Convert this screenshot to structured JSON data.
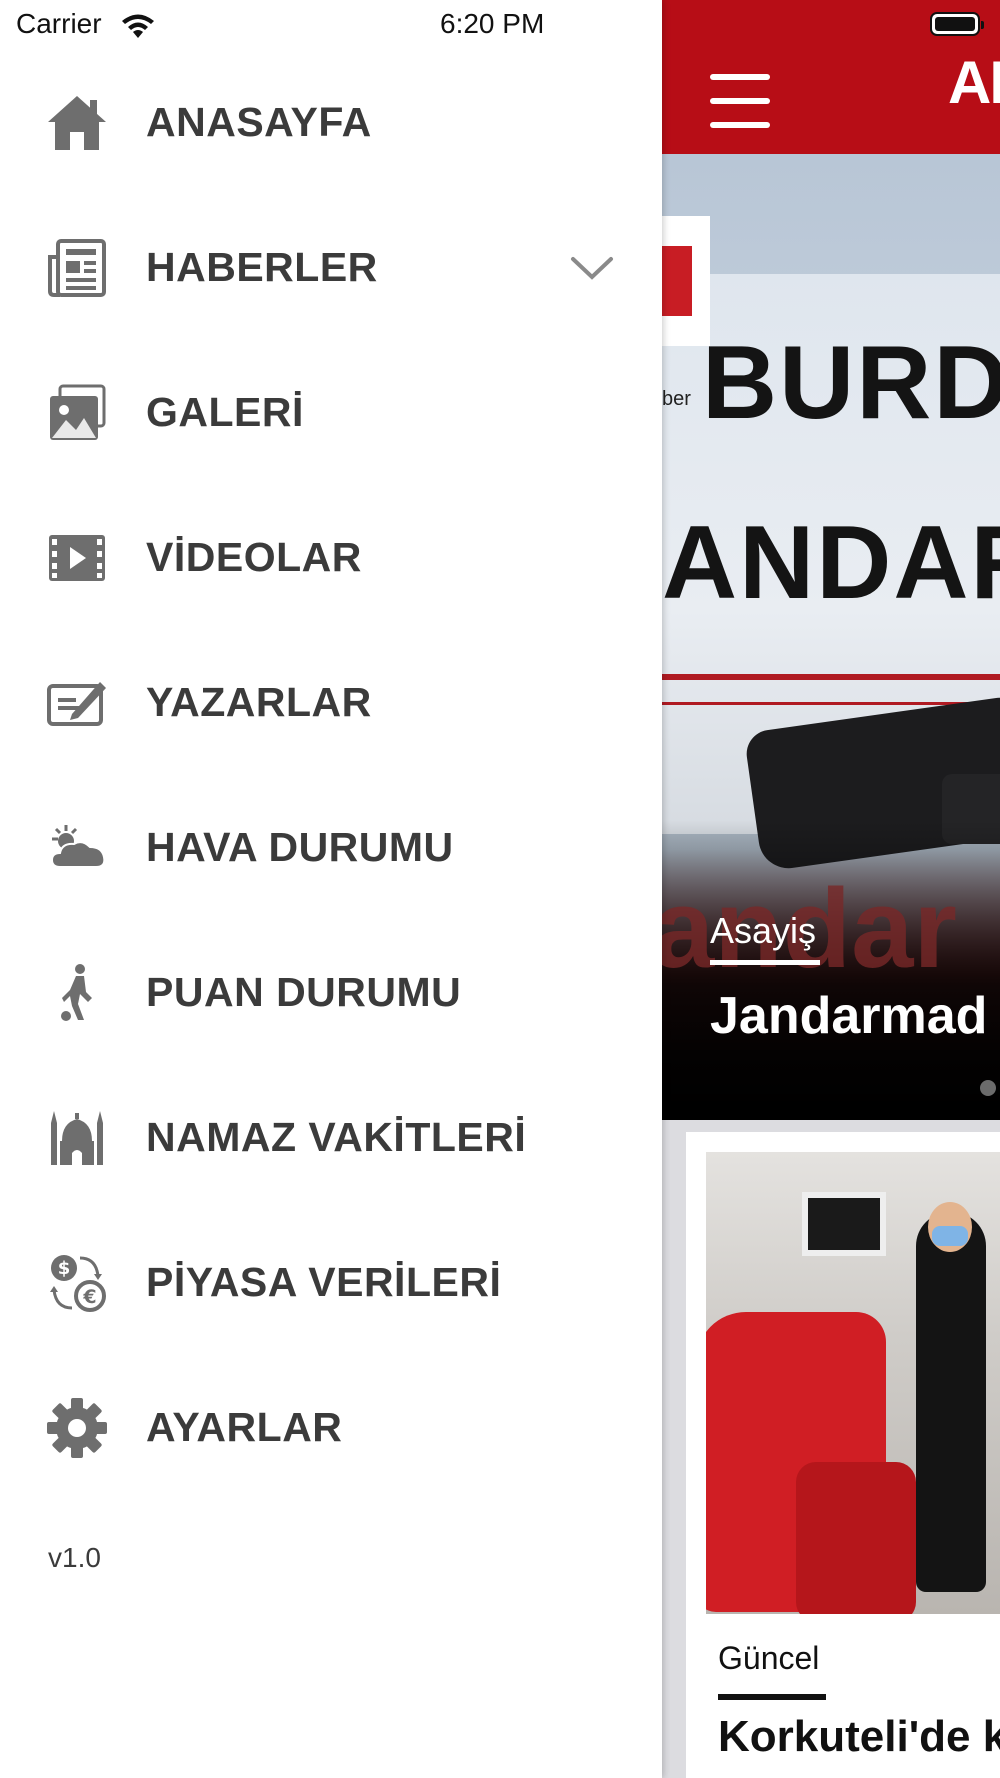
{
  "status_bar": {
    "carrier": "Carrier",
    "time": "6:20 PM"
  },
  "app": {
    "brand_partial": "AK",
    "hero": {
      "banner_line1": "BURD",
      "banner_line2": "ANDAR",
      "watermark": "andar",
      "logo_caption": "ber",
      "category": "Asayiş",
      "headline": "Jandarmad"
    },
    "card": {
      "category": "Güncel",
      "headline": "Korkuteli'de k"
    },
    "colors": {
      "header": "#b70d16",
      "menu_text": "#3b3b3b",
      "icon": "#6e6e6e"
    }
  },
  "drawer": {
    "items": [
      {
        "label": "ANASAYFA",
        "icon": "home-icon"
      },
      {
        "label": "HABERLER",
        "icon": "newspaper-icon",
        "expandable": true
      },
      {
        "label": "GALERİ",
        "icon": "gallery-icon"
      },
      {
        "label": "VİDEOLAR",
        "icon": "video-icon"
      },
      {
        "label": "YAZARLAR",
        "icon": "writer-icon"
      },
      {
        "label": "HAVA DURUMU",
        "icon": "weather-icon"
      },
      {
        "label": "PUAN DURUMU",
        "icon": "football-player-icon"
      },
      {
        "label": "NAMAZ VAKİTLERİ",
        "icon": "mosque-icon"
      },
      {
        "label": "PİYASA VERİLERİ",
        "icon": "currency-exchange-icon"
      },
      {
        "label": "AYARLAR",
        "icon": "gear-icon"
      }
    ],
    "version": "v1.0"
  }
}
